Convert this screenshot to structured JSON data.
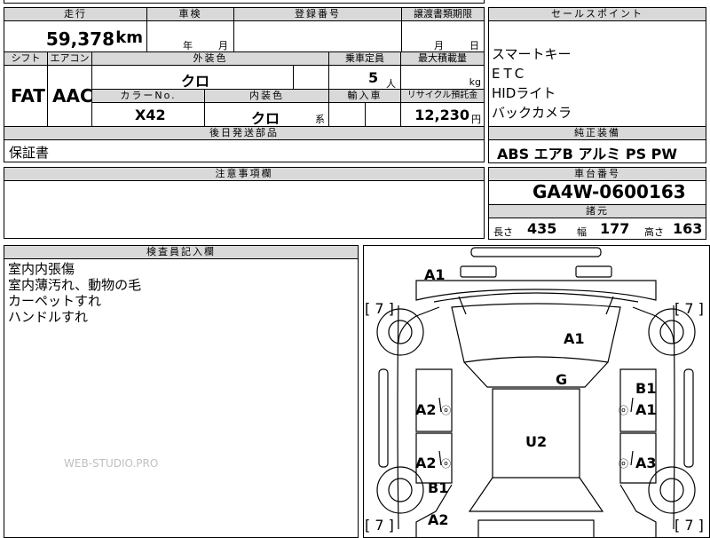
{
  "top_partial": {
    "a": "",
    "b": "",
    "c": "",
    "d": ""
  },
  "mileage": {
    "label": "走行",
    "value": "59,378",
    "unit": "km"
  },
  "inspection": {
    "label": "車検",
    "year_unit": "年",
    "month_unit": "月"
  },
  "registration": {
    "label": "登録番号",
    "value": ""
  },
  "transfer_deadline": {
    "label": "譲渡書類期限",
    "month_unit": "月",
    "day_unit": "日"
  },
  "shift": {
    "label": "シフト",
    "value": "FAT"
  },
  "aircon": {
    "label": "エアコン",
    "value": "AAC"
  },
  "exterior_color": {
    "label": "外装色",
    "value": "クロ"
  },
  "capacity": {
    "label": "乗車定員",
    "value": "5",
    "unit": "人"
  },
  "max_load": {
    "label": "最大積載量",
    "value": "",
    "unit": "kg"
  },
  "color_no": {
    "label": "カラーNo.",
    "value": "X42"
  },
  "interior_color": {
    "label": "内装色",
    "value": "クロ",
    "suffix": "系"
  },
  "import_car": {
    "label": "輸入車",
    "value": ""
  },
  "recycle_fee": {
    "label": "リサイクル預託金",
    "value": "12,230",
    "unit": "円"
  },
  "accessories": {
    "label": "後日発送部品",
    "value": "保証書"
  },
  "notes": {
    "label": "注意事項欄",
    "value": ""
  },
  "sales_points": {
    "label": "セールスポイント",
    "items": [
      "スマートキー",
      "ETC",
      "HIDライト",
      "バックカメラ"
    ]
  },
  "equipment": {
    "label": "純正装備",
    "value": "ABS エアB アルミ PS PW"
  },
  "chassis": {
    "label": "車台番号",
    "value": "GA4W-0600163"
  },
  "dimensions": {
    "label": "諸元",
    "length_label": "長さ",
    "length": "435",
    "width_label": "幅",
    "width": "177",
    "height_label": "高さ",
    "height": "163"
  },
  "inspector": {
    "label": "検査員記入欄",
    "lines": [
      "室内内張傷",
      "室内薄汚れ、動物の毛",
      "カーペットすれ",
      "ハンドルすれ"
    ]
  },
  "watermark": "WEB-STUDIO.PRO",
  "diagram": {
    "marks": {
      "front_bumper": "A1",
      "hood": "A1",
      "windshield": "G",
      "roof": "U2",
      "left_front_door": "A2",
      "left_rear_door": "A2",
      "left_rear_quarter": "B1",
      "left_rear_bumper": "A2",
      "right_front_fender_upper": "B1",
      "right_front_fender": "A1",
      "right_rear_door": "A3"
    },
    "tire_tl": "[ 7 ]",
    "tire_tr": "[ 7 ]",
    "tire_bl": "[ 7 ]",
    "tire_br": "[ 7 ]"
  }
}
